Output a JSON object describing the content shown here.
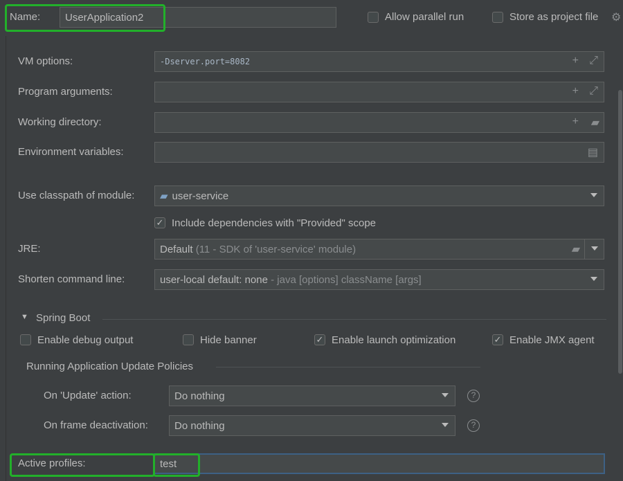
{
  "name": {
    "label": "Name:",
    "value": "UserApplication2"
  },
  "allow_parallel_run": {
    "label": "Allow parallel run",
    "checked": false
  },
  "store_as_project_file": {
    "label": "Store as project file",
    "checked": false
  },
  "vm_options": {
    "label": "VM options:",
    "value": "-Dserver.port=8082"
  },
  "program_arguments": {
    "label": "Program arguments:",
    "value": ""
  },
  "working_directory": {
    "label": "Working directory:",
    "value": ""
  },
  "environment_variables": {
    "label": "Environment variables:",
    "value": ""
  },
  "classpath_module": {
    "label": "Use classpath of module:",
    "value": "user-service"
  },
  "include_provided": {
    "label": "Include dependencies with \"Provided\" scope",
    "checked": true
  },
  "jre": {
    "label": "JRE:",
    "value": "Default",
    "hint": "(11 - SDK of 'user-service' module)"
  },
  "shorten_command_line": {
    "label": "Shorten command line:",
    "value": "user-local default: none",
    "hint": "- java [options] className [args]"
  },
  "spring_boot": {
    "title": "Spring Boot",
    "enable_debug_output": {
      "label": "Enable debug output",
      "checked": false
    },
    "hide_banner": {
      "label": "Hide banner",
      "checked": false
    },
    "enable_launch_optimization": {
      "label": "Enable launch optimization",
      "checked": true
    },
    "enable_jmx_agent": {
      "label": "Enable JMX agent",
      "checked": true
    },
    "update_policies_title": "Running Application Update Policies",
    "on_update": {
      "label": "On 'Update' action:",
      "value": "Do nothing"
    },
    "on_frame_deactivation": {
      "label": "On frame deactivation:",
      "value": "Do nothing"
    }
  },
  "active_profiles": {
    "label": "Active profiles:",
    "value": "test"
  },
  "colors": {
    "background": "#3c3f41",
    "highlight": "#22b02a",
    "focus": "#3d6185"
  }
}
